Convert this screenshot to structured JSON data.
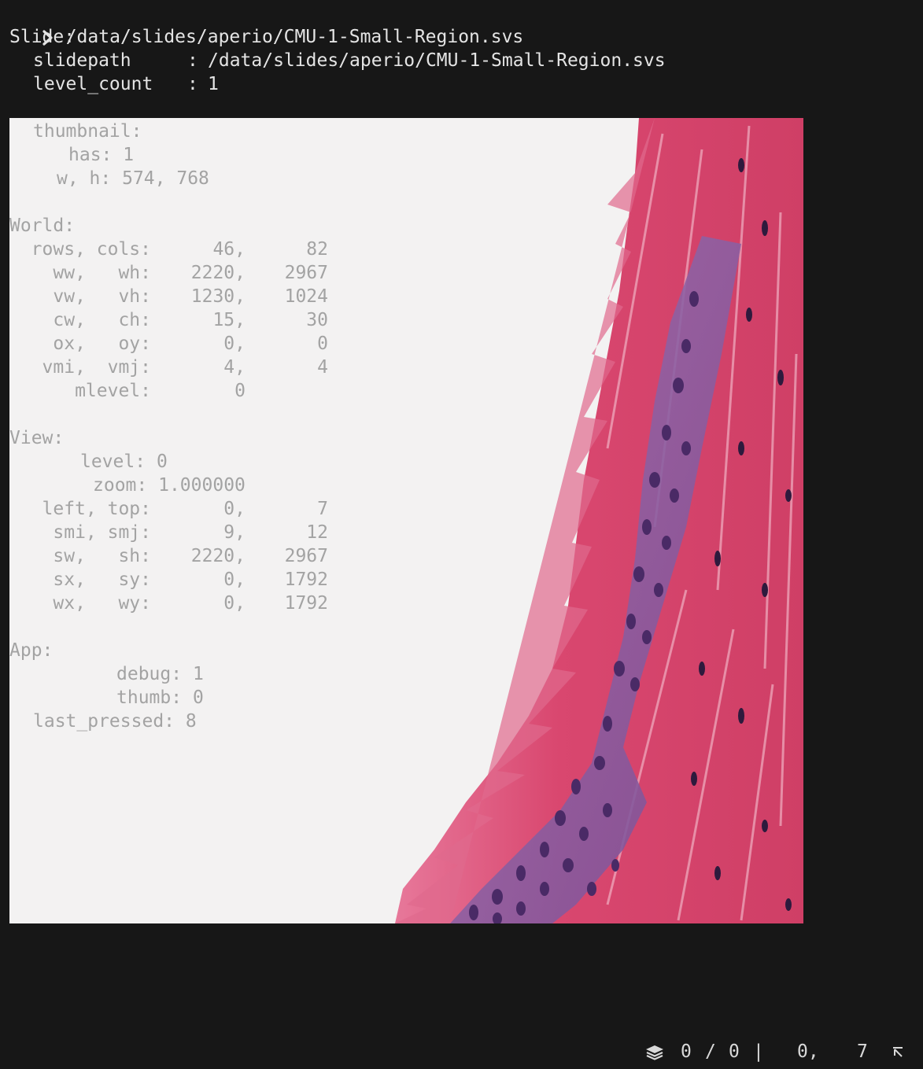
{
  "terminal": {
    "command": "/data/slides/aperio/CMU-1-Small-Region.svs",
    "slide_heading": "Slide:",
    "slidepath_key": "slidepath",
    "slidepath_value": "/data/slides/aperio/CMU-1-Small-Region.svs",
    "level_count_key": "level_count",
    "level_count_value": "1",
    "separator": ":"
  },
  "debug": {
    "thumbnail": {
      "heading": "thumbnail:",
      "has_label": "has:",
      "has_value": "1",
      "wh_label": "w, h:",
      "wh_value": "574, 768"
    },
    "world": {
      "heading": "World:",
      "rows": [
        {
          "label": "rows, cols:",
          "a": "46,",
          "b": "82"
        },
        {
          "label": "ww,   wh:",
          "a": "2220,",
          "b": "2967"
        },
        {
          "label": "vw,   vh:",
          "a": "1230,",
          "b": "1024"
        },
        {
          "label": "cw,   ch:",
          "a": "15,",
          "b": "30"
        },
        {
          "label": "ox,   oy:",
          "a": "0,",
          "b": "0"
        },
        {
          "label": "vmi,  vmj:",
          "a": "4,",
          "b": "4"
        },
        {
          "label": "mlevel:",
          "a": "0",
          "b": ""
        }
      ]
    },
    "view": {
      "heading": "View:",
      "level_label": "level:",
      "level_value": "0",
      "zoom_label": "zoom:",
      "zoom_value": "1.000000",
      "rows": [
        {
          "label": "left, top:",
          "a": "0,",
          "b": "7"
        },
        {
          "label": "smi, smj:",
          "a": "9,",
          "b": "12"
        },
        {
          "label": "sw,   sh:",
          "a": "2220,",
          "b": "2967"
        },
        {
          "label": "sx,   sy:",
          "a": "0,",
          "b": "1792"
        },
        {
          "label": "wx,   wy:",
          "a": "0,",
          "b": "1792"
        }
      ]
    },
    "app": {
      "heading": "App:",
      "debug_label": "debug:",
      "debug_value": "1",
      "thumb_label": "thumb:",
      "thumb_value": "0",
      "last_pressed_label": "last_pressed:",
      "last_pressed_value": "8"
    }
  },
  "statusbar": {
    "icon": "layers-icon",
    "level_current": "0",
    "level_sep": "/",
    "level_total": "0",
    "divider": "|",
    "pos_x": "0,",
    "pos_y": "7",
    "corner_icon": "arrow-up-left-icon"
  },
  "colors": {
    "background": "#171717",
    "text": "#e4e4e4",
    "debug_text": "#a3a3a3",
    "slide_background": "#f3f2f2",
    "stroma_pink": "#d9476f",
    "nuclei_purple": "#5b3a78"
  }
}
